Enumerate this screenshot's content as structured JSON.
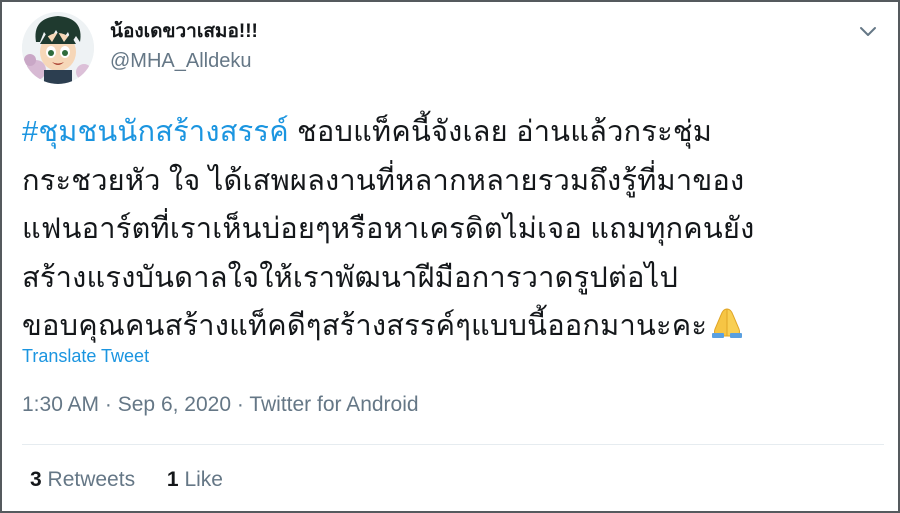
{
  "tweet": {
    "author": {
      "display_name": "น้องเดขวาเสมอ!!!",
      "handle": "@MHA_Alldeku"
    },
    "hashtag": "#ชุมชนนักสร้างสรรค์",
    "lines": [
      " ชอบแท็คนี้จังเลย อ่านแล้วกระชุ่ม",
      "กระชวยหัว ใจ ได้เสพผลงานที่หลากหลายรวมถึงรู้ที่มาของ",
      "แฟนอาร์ตที่เราเห็นบ่อยๆหรือหาเครดิตไม่เจอ แถมทุกคนยัง",
      "สร้างแรงบันดาลใจให้เราพัฒนาฝีมือการวาดรูปต่อไป",
      "ขอบคุณคนสร้างแท็คดีๆสร้างสรรค์ๆแบบนี้ออกมานะคะ"
    ],
    "emoji": "folded-hands-emoji",
    "translate_label": "Translate Tweet",
    "time": "1:30 AM",
    "separator": "·",
    "date": "Sep 6, 2020",
    "source": "Twitter for Android",
    "retweets": {
      "count": "3",
      "label": "Retweets"
    },
    "likes": {
      "count": "1",
      "label": "Like"
    }
  },
  "colors": {
    "link": "#1b95e0",
    "text": "#14171a",
    "muted": "#657786",
    "divider": "#e6ecf0"
  },
  "icons": [
    "avatar-anime-character",
    "chevron-down-icon",
    "folded-hands-emoji"
  ]
}
